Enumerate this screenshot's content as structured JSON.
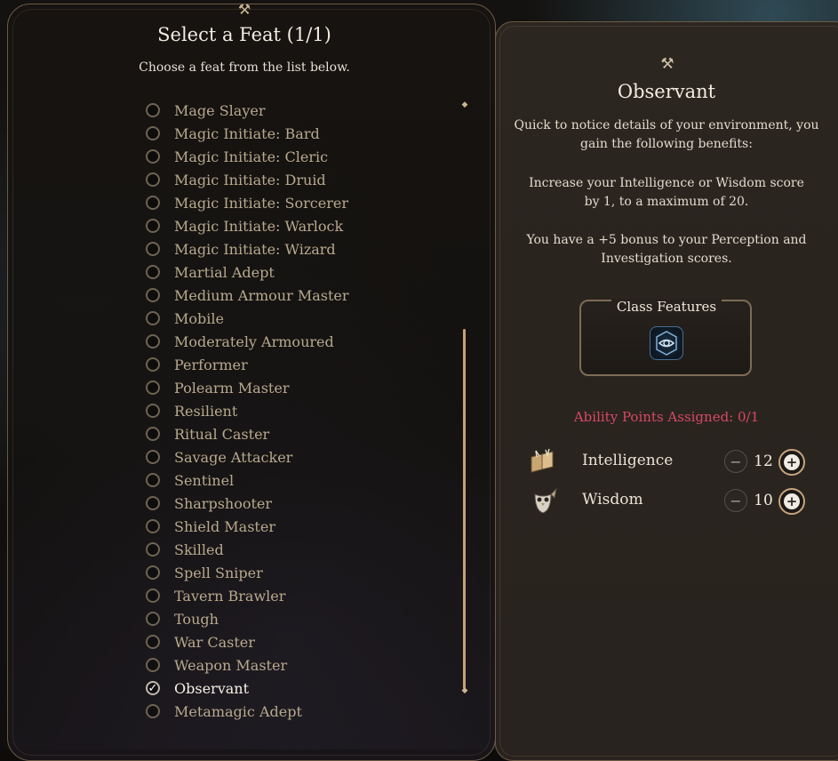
{
  "feat_selection": {
    "title": "Select a Feat (1/1)",
    "subtitle": "Choose a feat from the list below.",
    "feats": [
      {
        "label": "Mage Slayer",
        "selected": false
      },
      {
        "label": "Magic Initiate: Bard",
        "selected": false
      },
      {
        "label": "Magic Initiate: Cleric",
        "selected": false
      },
      {
        "label": "Magic Initiate: Druid",
        "selected": false
      },
      {
        "label": "Magic Initiate: Sorcerer",
        "selected": false
      },
      {
        "label": "Magic Initiate: Warlock",
        "selected": false
      },
      {
        "label": "Magic Initiate: Wizard",
        "selected": false
      },
      {
        "label": "Martial Adept",
        "selected": false
      },
      {
        "label": "Medium Armour Master",
        "selected": false
      },
      {
        "label": "Mobile",
        "selected": false
      },
      {
        "label": "Moderately Armoured",
        "selected": false
      },
      {
        "label": "Performer",
        "selected": false
      },
      {
        "label": "Polearm Master",
        "selected": false
      },
      {
        "label": "Resilient",
        "selected": false
      },
      {
        "label": "Ritual Caster",
        "selected": false
      },
      {
        "label": "Savage Attacker",
        "selected": false
      },
      {
        "label": "Sentinel",
        "selected": false
      },
      {
        "label": "Sharpshooter",
        "selected": false
      },
      {
        "label": "Shield Master",
        "selected": false
      },
      {
        "label": "Skilled",
        "selected": false
      },
      {
        "label": "Spell Sniper",
        "selected": false
      },
      {
        "label": "Tavern Brawler",
        "selected": false
      },
      {
        "label": "Tough",
        "selected": false
      },
      {
        "label": "War Caster",
        "selected": false
      },
      {
        "label": "Weapon Master",
        "selected": false
      },
      {
        "label": "Observant",
        "selected": true
      },
      {
        "label": "Metamagic Adept",
        "selected": false
      }
    ],
    "check_glyph": "✓",
    "icon": "crossed-hammers-icon"
  },
  "feat_detail": {
    "icon": "crossed-hammers-icon",
    "title": "Observant",
    "description": "Quick to notice details of your environment, you gain the following benefits:",
    "benefits": [
      "Increase your Intelligence or Wisdom score by 1, to a maximum of 20.",
      "You have a +5 bonus to your Perception and Investigation scores."
    ],
    "class_features_label": "Class Features",
    "class_feature_icon": "eye-icon",
    "ability_points": "Ability Points Assigned:  0/1",
    "abilities": [
      {
        "name": "Intelligence",
        "value": "12",
        "icon": "open-book-icon"
      },
      {
        "name": "Wisdom",
        "value": "10",
        "icon": "owl-icon"
      }
    ]
  },
  "colors": {
    "accent_gold": "#c8a077",
    "ability_points_red": "#d64a63",
    "selected_text": "#f6f0e4",
    "unselected_text": "#b8a98e"
  }
}
